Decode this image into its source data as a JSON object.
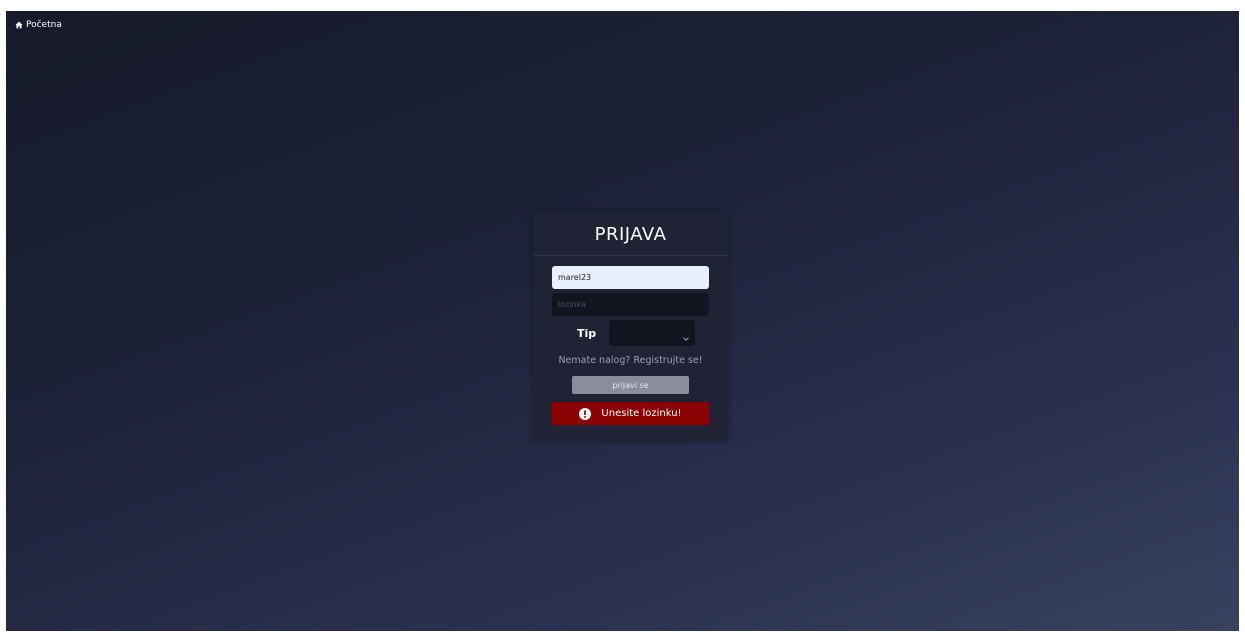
{
  "nav": {
    "home_label": "Početna",
    "home_icon": "home-icon"
  },
  "login": {
    "title": "PRIJAVA",
    "username_value": "marel23",
    "password_placeholder": "lozinka",
    "type_label": "Tip",
    "type_selected": "",
    "register_text": "Nemate nalog? Registrujte se!",
    "submit_label": "prijavi se",
    "error_message": "Unesite lozinku!",
    "error_icon": "exclamation-circle-icon"
  },
  "colors": {
    "error_bg": "#8b0000",
    "card_bg": "#1f2335",
    "input_dark": "#12141f",
    "input_autofill": "#e8f0fe",
    "button_bg": "#8a8e9b"
  }
}
